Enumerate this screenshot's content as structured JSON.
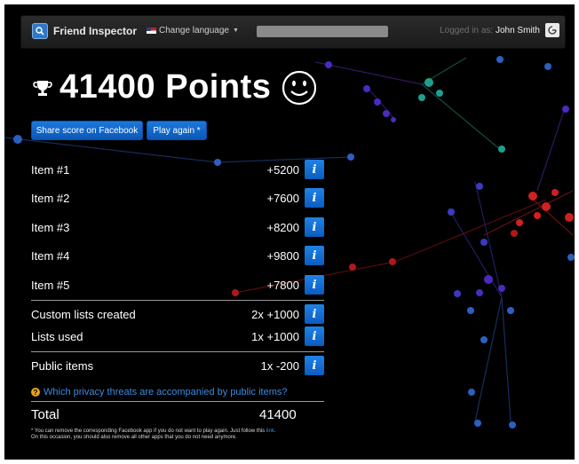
{
  "navbar": {
    "brand": "Friend Inspector",
    "language_label": "Change language",
    "logged_in_prefix": "Logged in as:",
    "user_name": "John Smith"
  },
  "score": {
    "points_text": "41400 Points"
  },
  "buttons": {
    "share": "Share score on Facebook",
    "play_again": "Play again *"
  },
  "items": [
    {
      "label": "Item #1",
      "value": "+5200"
    },
    {
      "label": "Item #2",
      "value": "+7600"
    },
    {
      "label": "Item #3",
      "value": "+8200"
    },
    {
      "label": "Item #4",
      "value": "+9800"
    },
    {
      "label": "Item #5",
      "value": "+7800"
    }
  ],
  "bonuses": [
    {
      "label": "Custom lists created",
      "value": "2x +1000"
    },
    {
      "label": "Lists used",
      "value": "1x +1000"
    }
  ],
  "penalties": [
    {
      "label": "Public items",
      "value": "1x -200"
    }
  ],
  "info_glyph": "i",
  "question_link": "Which privacy threats are accompanied by public items?",
  "total": {
    "label": "Total",
    "value": "41400"
  },
  "footnote": {
    "line1": "* You can remove the corresponding Facebook app if you do not want to play again. Just follow this",
    "link": "link",
    "line2": "On this occasion, you should also remove all other apps that you do not need anymore."
  },
  "colors": {
    "accent": "#0b66cc",
    "background": "#000000",
    "link": "#3b8be0"
  }
}
